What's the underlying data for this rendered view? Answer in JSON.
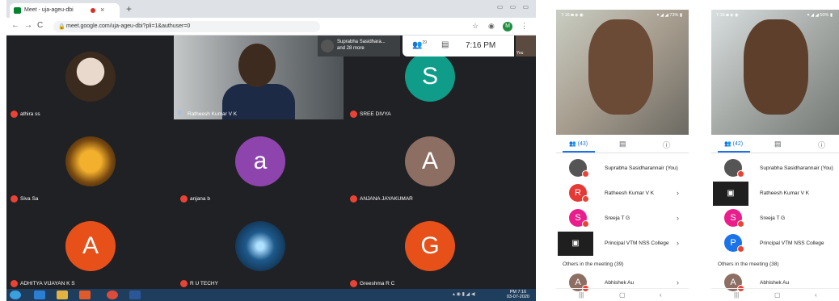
{
  "browser": {
    "tab_title": "Meet - uja-ageu-dbi",
    "tab_close": "×",
    "new_tab": "+",
    "window_controls": "▭ ▭ ▭",
    "url": "meet.google.com/uja-ageu-dbi?pli=1&authuser=0",
    "profile_letter": "M",
    "back": "←",
    "forward": "→",
    "reload": "C"
  },
  "meet": {
    "presenter_name": "Suprabha Sasidhara...",
    "presenter_more": "and 28 more",
    "participants_count": "29",
    "time": "7:16 PM",
    "self_label": "You",
    "tiles": [
      {
        "name": "athira ss",
        "avatar": "",
        "avatar_color": "",
        "kind": "photo"
      },
      {
        "name": "Ratheesh Kumar V K",
        "avatar": "",
        "avatar_color": "",
        "kind": "video"
      },
      {
        "name": "SREE DIVYA",
        "avatar": "S",
        "avatar_color": "#0f9d89",
        "kind": "letter"
      },
      {
        "name": "Siva Sa",
        "avatar": "",
        "avatar_color": "",
        "kind": "sunset"
      },
      {
        "name": "anjana b",
        "avatar": "a",
        "avatar_color": "#8e44ad",
        "kind": "letter"
      },
      {
        "name": "ANJANA JAYAKUMAR",
        "avatar": "A",
        "avatar_color": "#8d6e63",
        "kind": "letter"
      },
      {
        "name": "ADHITYA VIJAYAN K S",
        "avatar": "A",
        "avatar_color": "#e8501a",
        "kind": "letter"
      },
      {
        "name": "R U TECHY",
        "avatar": "",
        "avatar_color": "",
        "kind": "space"
      },
      {
        "name": "Greeshma R C",
        "avatar": "G",
        "avatar_color": "#e8501a",
        "kind": "letter"
      }
    ]
  },
  "taskbar": {
    "clock_time": "PM 7:16",
    "clock_date": "03-07-2020"
  },
  "phone1": {
    "status_left": "7:16 ◙ ◈ ◉",
    "status_right": "▾ ◢ ◢ 73% ▮",
    "people_tab": "(43)",
    "participants": [
      {
        "name": "Suprabha Sasidharannair (You)",
        "avatar": "",
        "color": "#555555"
      },
      {
        "name": "Ratheesh Kumar V K",
        "avatar": "R",
        "color": "#e53935"
      },
      {
        "name": "Sreeja T G",
        "avatar": "S",
        "color": "#e91e8c"
      },
      {
        "name": "Principal VTM NSS College",
        "avatar": "▣",
        "color": "#1f1f1f"
      }
    ],
    "others_label": "Others in the meeting (39)",
    "others_first": {
      "name": "Abhishek Au",
      "avatar": "A",
      "color": "#8d6e63"
    }
  },
  "phone2": {
    "status_left": "7:16 ◙ ◈ ◉",
    "status_right": "▾ ◢ ◢ 50% ▮",
    "people_tab": "(42)",
    "participants": [
      {
        "name": "Suprabha Sasidharannair (You)",
        "avatar": "",
        "color": "#555555"
      },
      {
        "name": "Ratheesh Kumar V K",
        "avatar": "▣",
        "color": "#1f1f1f"
      },
      {
        "name": "Sreeja T G",
        "avatar": "S",
        "color": "#e91e8c"
      },
      {
        "name": "Principal VTM NSS College",
        "avatar": "P",
        "color": "#1a73e8"
      }
    ],
    "others_label": "Others in the meeting (38)",
    "others_first": {
      "name": "Abhishek Au",
      "avatar": "A",
      "color": "#8d6e63"
    }
  }
}
